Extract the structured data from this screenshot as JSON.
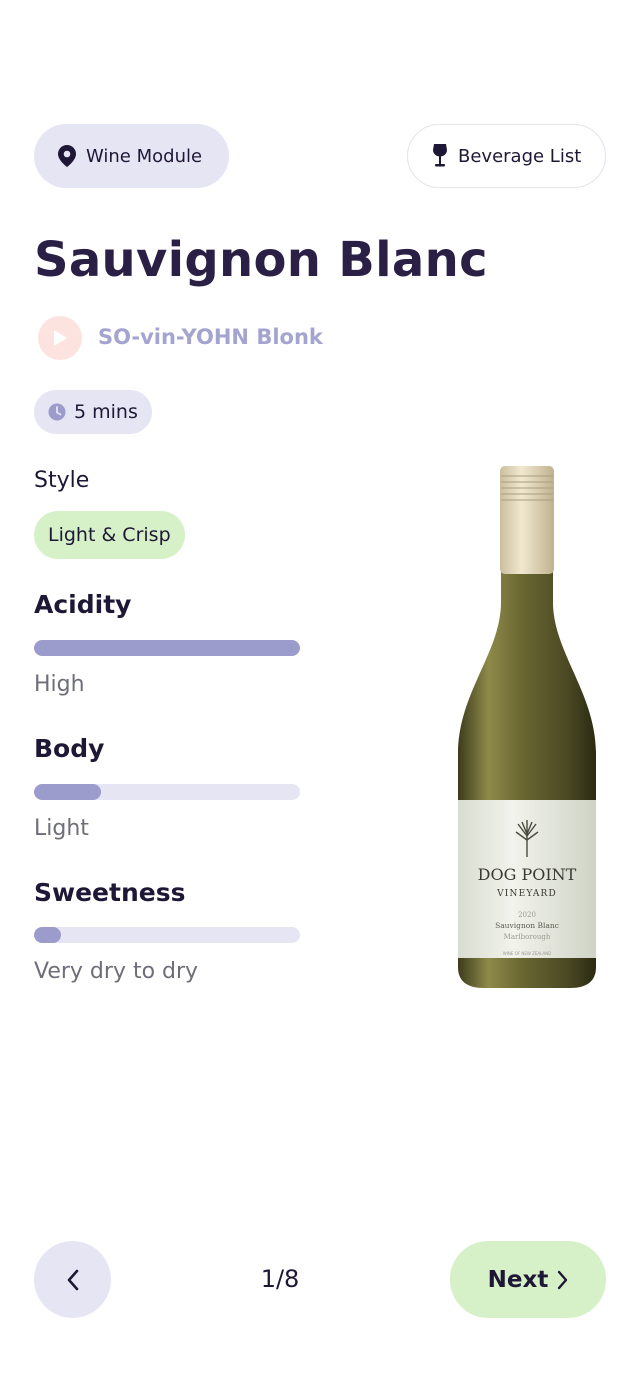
{
  "header": {
    "wine_module_label": "Wine Module",
    "wine_module_icon": "map-pin-icon",
    "beverage_list_label": "Beverage List",
    "beverage_list_icon": "wine-glass-icon"
  },
  "wine": {
    "name": "Sauvignon Blanc",
    "pronunciation": "SO-vin-YOHN Blonk",
    "duration": "5 mins",
    "style_heading": "Style",
    "style": "Light & Crisp"
  },
  "metrics": [
    {
      "label": "Acidity",
      "value_text": "High",
      "level": 1.0
    },
    {
      "label": "Body",
      "value_text": "Light",
      "level": 0.25
    },
    {
      "label": "Sweetness",
      "value_text": "Very dry to dry",
      "level": 0.1
    }
  ],
  "bottle_label": {
    "brand": "DOG POINT",
    "sub": "VINEYARD",
    "year": "2020",
    "variety": "Sauvignon Blanc",
    "region": "Marlborough",
    "origin": "WINE OF NEW ZEALAND"
  },
  "pagination": {
    "indicator": "1/8",
    "next_label": "Next"
  },
  "colors": {
    "accent_lavender": "#9b9bcc",
    "chip_lavender": "#e6e5f4",
    "accent_green": "#d6f1c8",
    "play_pink": "#fde3df",
    "title_dark": "#2a1f45"
  }
}
